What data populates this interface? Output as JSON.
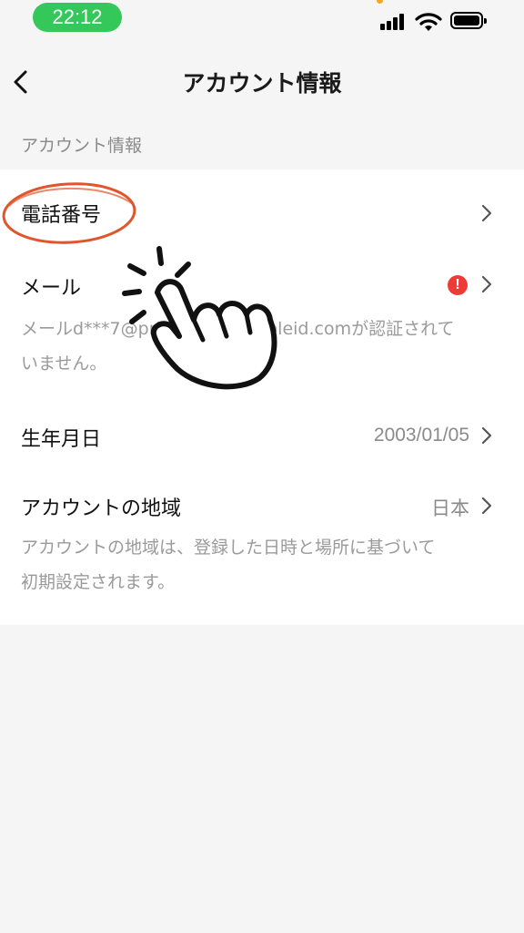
{
  "status_bar": {
    "time": "22:12"
  },
  "nav": {
    "title": "アカウント情報"
  },
  "section": {
    "label": "アカウント情報"
  },
  "rows": {
    "phone": {
      "label": "電話番号"
    },
    "email": {
      "label": "メール",
      "note_line1": "メールd***7@privaterelay.appleid.comが認証されて",
      "note_line2": "いません。"
    },
    "birthday": {
      "label": "生年月日",
      "value": "2003/01/05"
    },
    "region": {
      "label": "アカウントの地域",
      "value": "日本",
      "note_line1": "アカウントの地域は、登録した日時と場所に基づいて",
      "note_line2": "初期設定されます。"
    }
  },
  "colors": {
    "status_pill": "#34c759",
    "alert": "#ef3b35",
    "annotation": "#e0552b"
  },
  "icons": [
    "back-icon",
    "chevron-right-icon",
    "alert-icon",
    "signal-icon",
    "wifi-icon",
    "battery-icon",
    "hand-pointer-icon"
  ]
}
